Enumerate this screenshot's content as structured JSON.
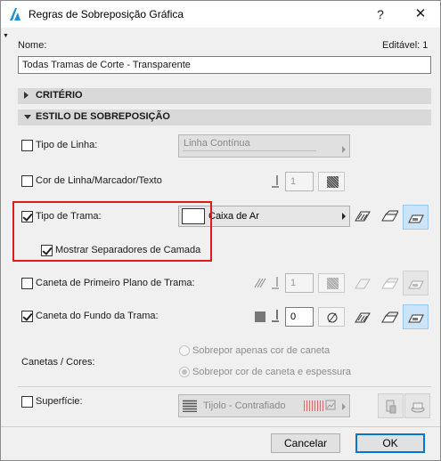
{
  "window": {
    "title": "Regras de Sobreposição Gráfica",
    "help_label": "?",
    "close_label": "✕"
  },
  "name_section": {
    "name_label": "Nome:",
    "editable_label": "Editável: 1",
    "name_value": "Todas Tramas de Corte - Transparente"
  },
  "sections": {
    "criterio": "CRITÉRIO",
    "estilo": "ESTILO DE SOBREPOSIÇÃO"
  },
  "rows": {
    "tipo_linha": {
      "label": "Tipo de Linha:",
      "checked": false,
      "value": "Linha Contínua"
    },
    "cor_linha": {
      "label": "Cor de Linha/Marcador/Texto",
      "checked": false,
      "pen": "1"
    },
    "tipo_trama": {
      "label": "Tipo de Trama:",
      "checked": true,
      "value": "Caixa de Ar"
    },
    "mostrar_sep": {
      "label": "Mostrar Separadores de Camada",
      "checked": true
    },
    "caneta_primeiro": {
      "label": "Caneta de Primeiro Plano de Trama:",
      "checked": false,
      "pen": "1"
    },
    "caneta_fundo": {
      "label": "Caneta do Fundo da Trama:",
      "checked": true,
      "pen": "0"
    }
  },
  "canetas": {
    "label": "Canetas / Cores:",
    "option1": "Sobrepor apenas cor de caneta",
    "option2": "Sobrepor cor de caneta e espessura",
    "selected": "option2"
  },
  "superficie": {
    "label": "Superfície:",
    "checked": false,
    "value": "Tijolo - Contrafiado"
  },
  "buttons": {
    "cancel": "Cancelar",
    "ok": "OK"
  },
  "colors": {
    "highlight": "#e11b1b",
    "selected_button": "#cce4f7",
    "ok_border": "#0078d7"
  },
  "icons": [
    "archicad-logo-icon",
    "help-icon",
    "close-icon",
    "pen-icon",
    "hatch-pattern-icon",
    "slash-circle-icon"
  ]
}
